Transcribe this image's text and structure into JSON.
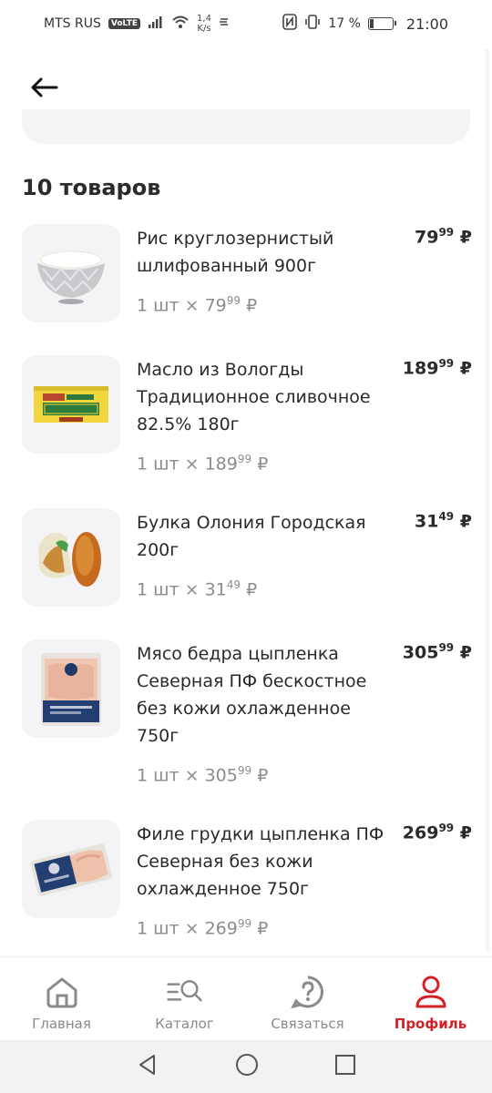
{
  "status_bar": {
    "carrier": "MTS RUS",
    "volte": "VoLTE",
    "speed_value": "1,4",
    "speed_unit": "K/s",
    "battery": "17 %",
    "battery_level": 0.17,
    "time": "21:00"
  },
  "header": {
    "back_icon": "arrow-left-icon"
  },
  "order": {
    "count_title": "10 товаров",
    "items": [
      {
        "name": "Рис круглозернистый шлифованный 900г",
        "price_int": "79",
        "price_frac": "99",
        "currency": "₽",
        "qty_label": "1 шт × ",
        "image": "rice-bowl"
      },
      {
        "name": "Масло из Вологды Традиционное сливочное 82.5% 180г",
        "price_int": "189",
        "price_frac": "99",
        "currency": "₽",
        "qty_label": "1 шт × ",
        "image": "butter-pack"
      },
      {
        "name": "Булка Олония Городская 200г",
        "price_int": "31",
        "price_frac": "49",
        "currency": "₽",
        "qty_label": "1 шт × ",
        "image": "bread-bun"
      },
      {
        "name": "Мясо бедра цыпленка Северная ПФ бескостное без кожи охлажденное 750г",
        "price_int": "305",
        "price_frac": "99",
        "currency": "₽",
        "qty_label": "1 шт × ",
        "image": "chicken-tray"
      },
      {
        "name": "Филе грудки цыпленка ПФ Северная без кожи охлажденное 750г",
        "price_int": "269",
        "price_frac": "99",
        "currency": "₽",
        "qty_label": "1 шт × ",
        "image": "chicken-fillet-tray"
      }
    ]
  },
  "bottom_nav": {
    "items": [
      {
        "label": "Главная",
        "icon": "home-icon",
        "active": false
      },
      {
        "label": "Каталог",
        "icon": "catalog-search-icon",
        "active": false
      },
      {
        "label": "Связаться",
        "icon": "help-question-icon",
        "active": false
      },
      {
        "label": "Профиль",
        "icon": "profile-icon",
        "active": true
      }
    ]
  },
  "colors": {
    "accent": "#d42027",
    "muted": "#8c8c8c",
    "thumb_bg": "#f4f4f6"
  }
}
